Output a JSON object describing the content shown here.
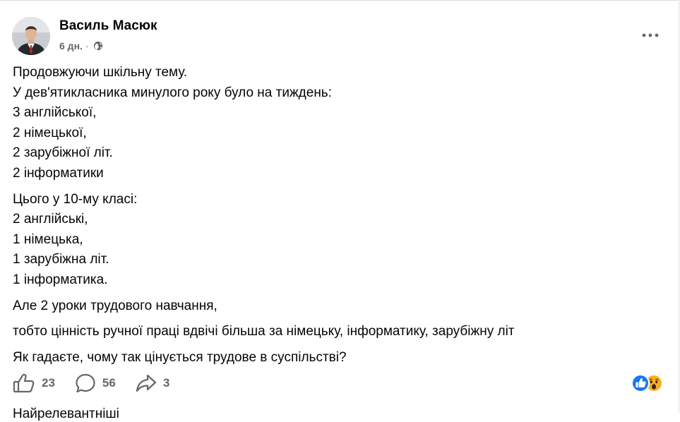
{
  "post": {
    "author": "Василь Масюк",
    "time": "6 дн.",
    "meta_separator": "·",
    "audience_icon": "globe-icon",
    "more_icon": "more-horizontal-icon",
    "text_lines": [
      "Продовжуючи шкільну тему.",
      "У дев'ятикласника минулого року було на тиждень:",
      "3 англійської,",
      "2 німецької,",
      "2 зарубіжної літ.",
      "2 інформатики",
      "Цього у 10-му класі:",
      "2 англійські,",
      "1 німецька,",
      "1 зарубіжна літ.",
      "1 інформатика.",
      "Але 2 уроки трудового навчання,",
      "тобто цінність ручної праці вдвічі більша за німецьку, інформатику, зарубіжну літ",
      "Як гадаєте, чому так цінується трудове в суспільстві?"
    ]
  },
  "actions": {
    "like_count": "23",
    "comment_count": "56",
    "share_count": "3",
    "like_icon": "thumbs-up-icon",
    "comment_icon": "comment-bubble-icon",
    "share_icon": "share-arrow-icon"
  },
  "reactions": {
    "icons": [
      "like-reaction-icon",
      "wow-reaction-icon"
    ],
    "like_color": "#1877f2",
    "wow_color": "#f7b125"
  },
  "comment_peek": "Найрелевантніші",
  "colors": {
    "text": "#050505",
    "secondary": "#65676b",
    "border": "#dadde1"
  }
}
